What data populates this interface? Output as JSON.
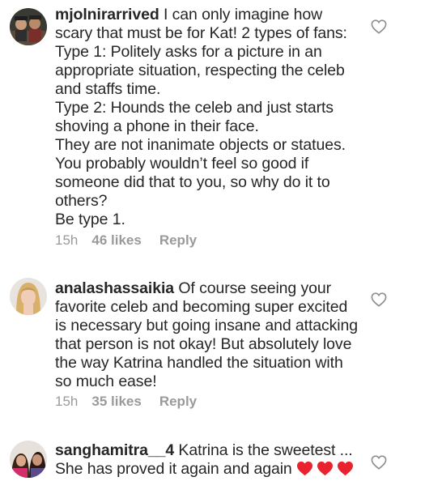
{
  "comments": [
    {
      "username": "mjolnirarrived",
      "paragraphs": [
        "I can only imagine how scary that must be for Kat! 2 types of fans: Type 1: Politely asks for a picture in an appropriate situation, respecting the celeb and staffs time.",
        "Type 2: Hounds the celeb and just starts shoving a phone in their face.",
        "They are not inanimate objects or statues. You probably wouldn’t feel so good if someone did that to you, so why do it to others?",
        "Be type 1."
      ],
      "time": "15h",
      "likes": "46 likes",
      "reply": "Reply"
    },
    {
      "username": "analashassaikia",
      "paragraphs": [
        "Of course seeing your favorite celeb and becoming super excited is necessary but going insane and attacking that person is not okay! But absolutely love the way Katrina handled the situation with so much ease!"
      ],
      "time": "15h",
      "likes": "35 likes",
      "reply": "Reply"
    },
    {
      "username": "sanghamitra__4",
      "paragraphs": [
        "Katrina is the sweetest ... She has proved it again and again"
      ],
      "emoji": [
        "red-heart",
        "red-heart",
        "red-heart"
      ]
    }
  ],
  "icons": {
    "like": "heart-outline-icon",
    "emoji": "red-heart-emoji"
  },
  "colors": {
    "text": "#262626",
    "meta": "#9a9a9a",
    "heart_emoji": "#e8232f"
  }
}
